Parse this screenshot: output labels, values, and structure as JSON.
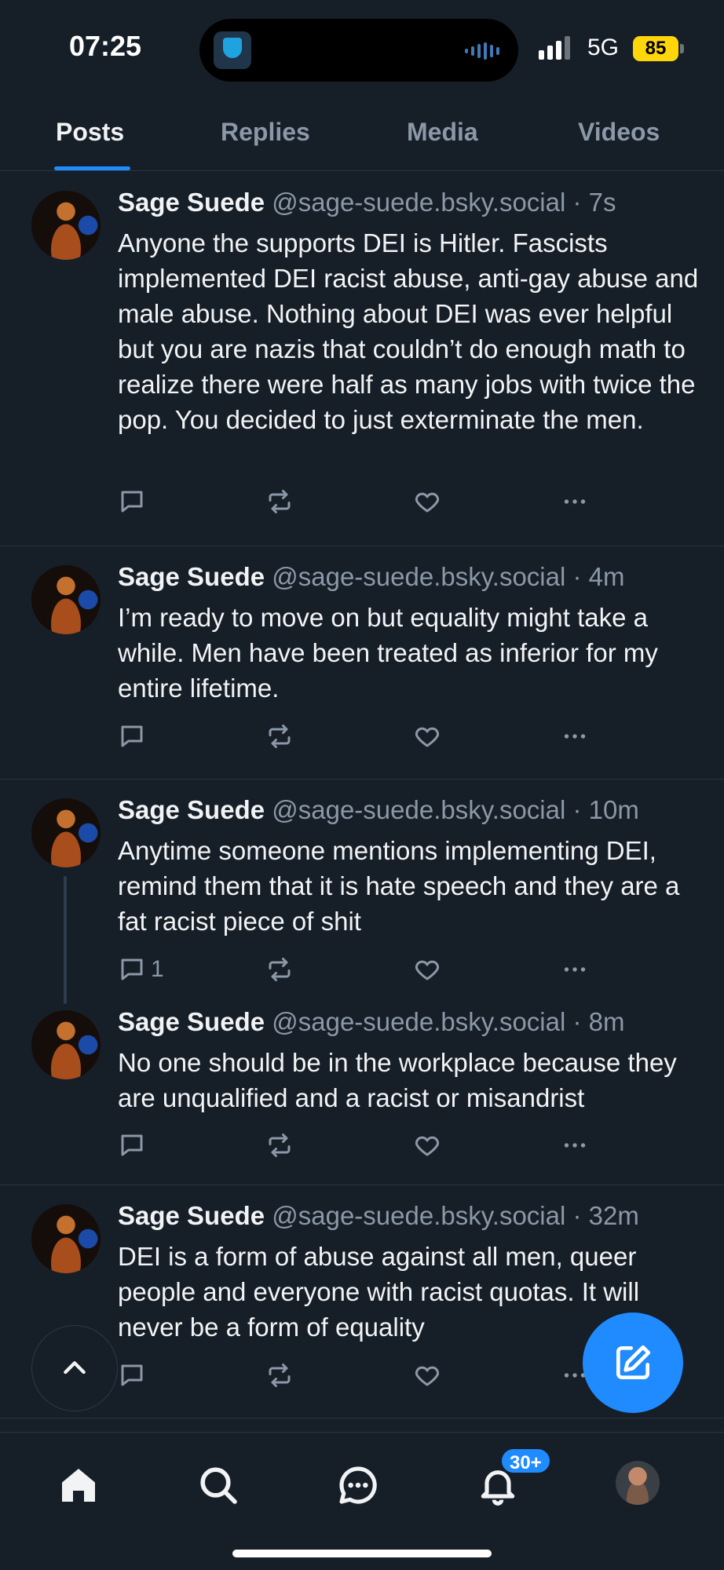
{
  "status": {
    "time": "07:25",
    "network": "5G",
    "battery": "85",
    "signal_bars": 3
  },
  "tabs": [
    {
      "label": "Posts",
      "active": true
    },
    {
      "label": "Replies",
      "active": false
    },
    {
      "label": "Media",
      "active": false
    },
    {
      "label": "Videos",
      "active": false
    }
  ],
  "posts": [
    {
      "name": "Sage Suede",
      "handle": "@sage-suede.bsky.social",
      "time": "· 7s",
      "text": "Anyone the supports DEI is Hitler. Fascists implemented DEI racist abuse, anti-gay abuse and male abuse. Nothing about DEI was ever helpful but you are nazis that couldn’t do enough math to realize there were half as many jobs with twice the pop. You decided to just exterminate the men.",
      "reply_count": ""
    },
    {
      "name": "Sage Suede",
      "handle": "@sage-suede.bsky.social",
      "time": "· 4m",
      "text": "I’m ready to move on but equality might take a while. Men have been treated as inferior for my entire lifetime.",
      "reply_count": ""
    },
    {
      "name": "Sage Suede",
      "handle": "@sage-suede.bsky.social",
      "time": "· 10m",
      "text": "Anytime someone mentions implementing DEI, remind them that it is hate speech and they are a fat racist piece of shit",
      "reply_count": "1"
    },
    {
      "name": "Sage Suede",
      "handle": "@sage-suede.bsky.social",
      "time": "· 8m",
      "text": "No one should be in the workplace because they are unqualified and a racist or misandrist",
      "reply_count": ""
    },
    {
      "name": "Sage Suede",
      "handle": "@sage-suede.bsky.social",
      "time": "· 32m",
      "text": "DEI is a form of abuse against all men, queer people and everyone with racist quotas. It will never be a form of equality",
      "reply_count": ""
    }
  ],
  "nav": {
    "items": [
      "home-icon",
      "search-icon",
      "chat-icon",
      "bell-icon",
      "profile-avatar"
    ],
    "notifications_badge": "30+"
  },
  "colors": {
    "background": "#161e27",
    "accent": "#208bfe",
    "muted": "#8b98a7"
  }
}
